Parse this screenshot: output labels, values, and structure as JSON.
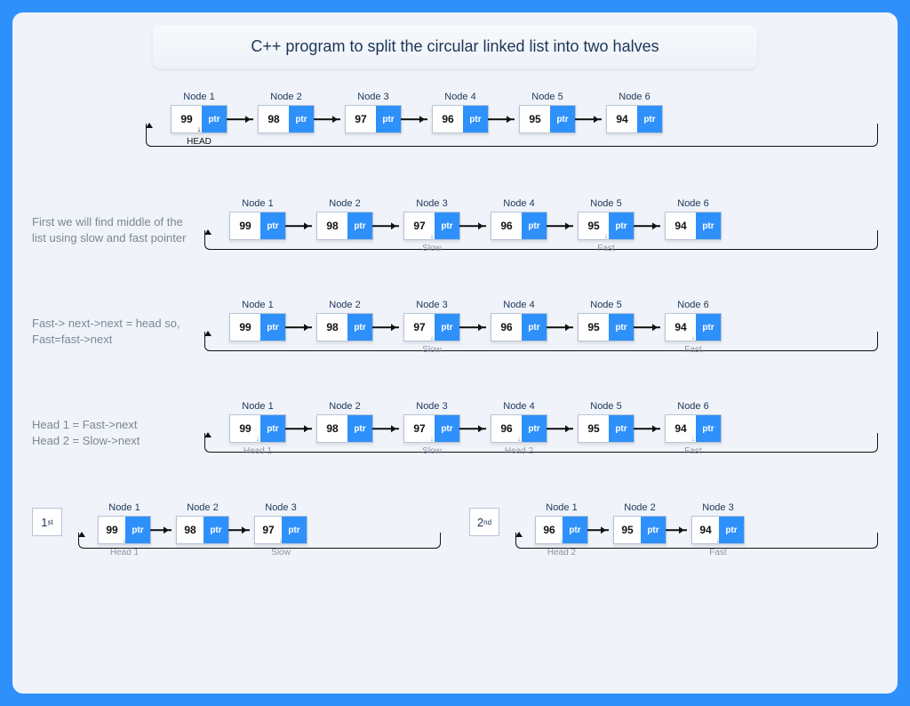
{
  "title": "C++ program to split the circular linked list into two halves",
  "ptr_text": "ptr",
  "head_text": "HEAD",
  "captions": {
    "step1": "First we will find middle of the list using slow and fast pointer",
    "step2": "Fast-> next->next = head so, Fast=fast->next",
    "step3": "Head 1 = Fast->next\nHead 2 = Slow->next"
  },
  "labels": {
    "slow": "Slow",
    "fast": "Fast",
    "head1": "Head 1",
    "head2": "Head 2"
  },
  "ordinals": {
    "first": "1",
    "first_sup": "st",
    "second": "2",
    "second_sup": "nd"
  },
  "lists": {
    "main": [
      {
        "n": "Node 1",
        "v": "99"
      },
      {
        "n": "Node 2",
        "v": "98"
      },
      {
        "n": "Node 3",
        "v": "97"
      },
      {
        "n": "Node 4",
        "v": "96"
      },
      {
        "n": "Node 5",
        "v": "95"
      },
      {
        "n": "Node 6",
        "v": "94"
      }
    ],
    "half1": [
      {
        "n": "Node 1",
        "v": "99"
      },
      {
        "n": "Node 2",
        "v": "98"
      },
      {
        "n": "Node 3",
        "v": "97"
      }
    ],
    "half2": [
      {
        "n": "Node 1",
        "v": "96"
      },
      {
        "n": "Node 2",
        "v": "95"
      },
      {
        "n": "Node 3",
        "v": "94"
      }
    ]
  }
}
